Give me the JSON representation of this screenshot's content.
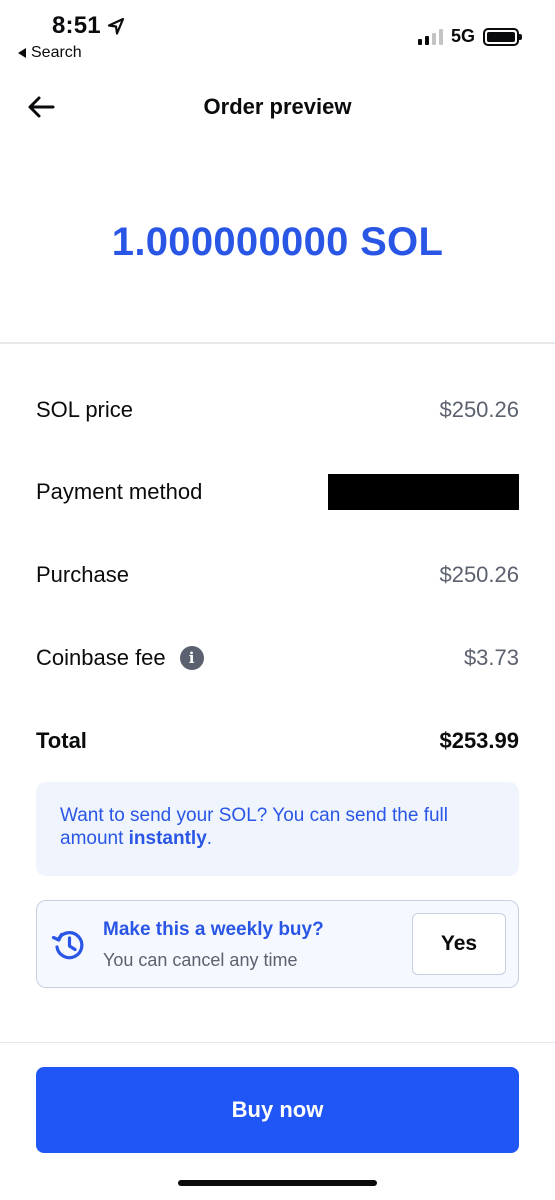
{
  "status_bar": {
    "time": "8:51",
    "back_label": "Search",
    "network": "5G",
    "signal_bars": 2,
    "battery_level": 1.0
  },
  "header": {
    "title": "Order preview",
    "back_icon": "arrow-left-icon"
  },
  "amount": "1.000000000 SOL",
  "rows": [
    {
      "label": "SOL price",
      "value": "$250.26"
    },
    {
      "label": "Payment method",
      "value": ""
    },
    {
      "label": "Purchase",
      "value": "$250.26"
    },
    {
      "label": "Coinbase fee",
      "value": "$3.73"
    },
    {
      "label": "Total",
      "value": "$253.99"
    }
  ],
  "banner": {
    "text_before": "Want to send your SOL? You can send the full amount ",
    "bold": "instantly",
    "text_after": "."
  },
  "weekly": {
    "icon": "history-icon",
    "title": "Make this a weekly buy?",
    "subtitle": "You can cancel any time",
    "yes_label": "Yes"
  },
  "buy_label": "Buy now",
  "colors": {
    "accent": "#2a56e6",
    "button": "#1f56f5",
    "secondary_text": "#5b616e",
    "banner_bg": "#f0f4fd"
  }
}
